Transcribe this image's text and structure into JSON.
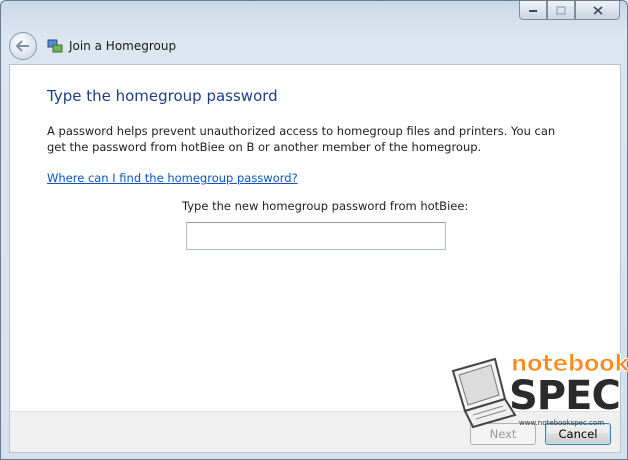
{
  "window": {
    "title": "Join a Homegroup",
    "minimize_glyph": "▭",
    "maximize_glyph": "▢",
    "close_glyph": "✕"
  },
  "content": {
    "heading": "Type the homegroup password",
    "description": "A password helps prevent unauthorized access to homegroup files and printers. You can get the password from hotBiee on B or another member of the homegroup.",
    "help_link": "Where can I find the homegroup password?",
    "password_label": "Type the new homegroup password from hotBiee:",
    "password_value": ""
  },
  "footer": {
    "next_label": "Next",
    "cancel_label": "Cancel"
  },
  "watermark": {
    "brand_top": "notebook",
    "brand_main": "SPEC",
    "url": "www.notebookspec.com"
  },
  "colors": {
    "heading": "#1e3f8a",
    "link": "#0a56c2",
    "watermark_orange": "#ff8a1a"
  },
  "icons": [
    "back-arrow-icon",
    "homegroup-icon",
    "minimize-icon",
    "maximize-icon",
    "close-icon",
    "laptop-icon"
  ]
}
